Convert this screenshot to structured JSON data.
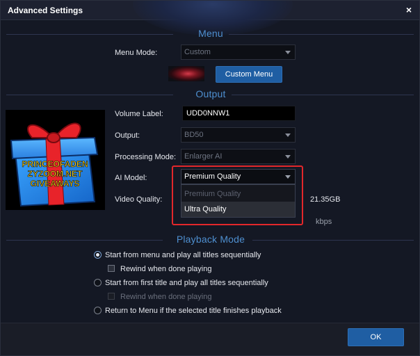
{
  "window": {
    "title": "Advanced Settings",
    "close_glyph": "×"
  },
  "menu": {
    "heading": "Menu",
    "mode_label": "Menu Mode:",
    "mode_value": "Custom",
    "custom_button": "Custom Menu"
  },
  "output": {
    "heading": "Output",
    "volume_label": "Volume Label:",
    "volume_value": "UDD0NNW1",
    "output_label": "Output:",
    "output_value": "BD50",
    "processing_label": "Processing Mode:",
    "processing_value": "Enlarger AI",
    "ai_label": "AI Model:",
    "ai_value": "Premium Quality",
    "ai_options": [
      "Premium Quality",
      "Ultra Quality"
    ],
    "video_quality_label": "Video Quality:",
    "size_text": "21.35GB",
    "kbps_text": "kbps"
  },
  "promo": {
    "lines": [
      "PRINCEOFADEN",
      "ZYZOOM.NET",
      "GIVEAWAYS"
    ]
  },
  "playback": {
    "heading": "Playback Mode",
    "options": [
      "Start from menu and play all titles sequentially",
      "Rewind when done playing",
      "Start from first title and play all titles sequentially",
      "Rewind when done playing",
      "Return to Menu if the selected title finishes playback"
    ]
  },
  "footer": {
    "ok_label": "OK"
  },
  "colors": {
    "accent": "#4e8fd0",
    "button": "#1f5ea3",
    "highlight_border": "#e3272b"
  },
  "icons": [
    "close-icon",
    "chevron-down-icon",
    "radio-icon",
    "checkbox-icon",
    "gift-icon"
  ]
}
